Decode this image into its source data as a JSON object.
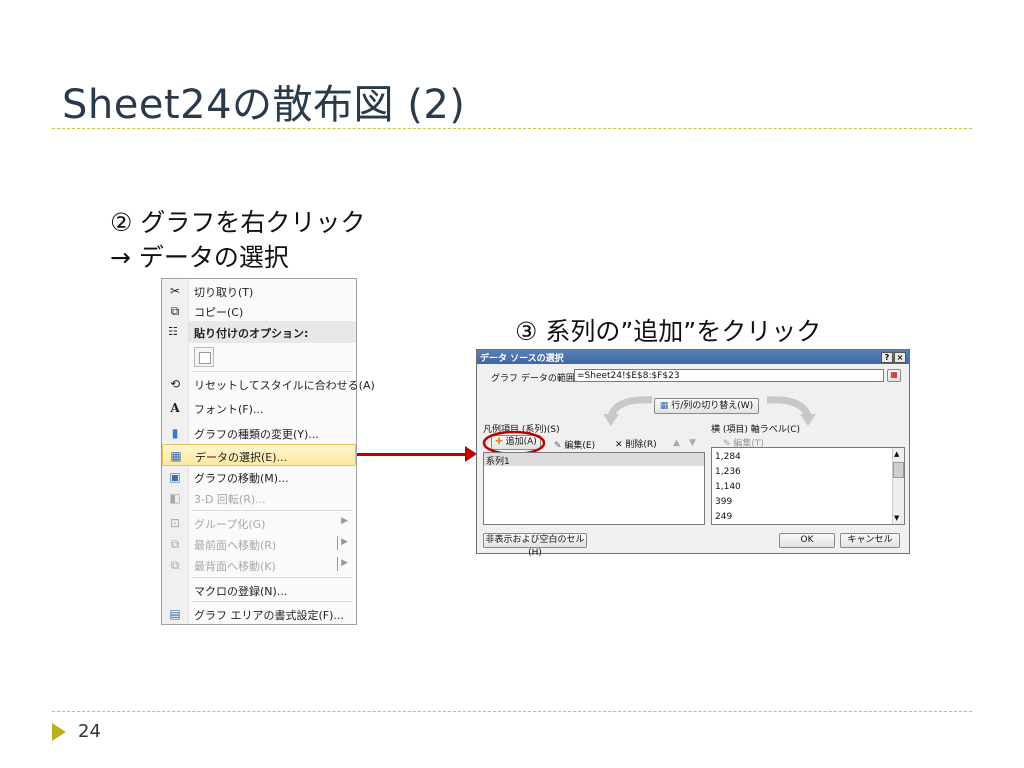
{
  "slide": {
    "title": "Sheet24の散布図 (2)",
    "step2_line1": "② グラフを右クリック",
    "step2_line2": "→ データの選択",
    "step3": "③ 系列の”追加”をクリック",
    "page_number": "24"
  },
  "context_menu": {
    "items": [
      {
        "icon": "scissors-icon",
        "glyph": "✂",
        "label": "切り取り(T)"
      },
      {
        "icon": "copy-icon",
        "glyph": "⧉",
        "label": "コピー(C)"
      },
      {
        "icon": "paste-icon",
        "glyph": "📋",
        "label": "貼り付けのオプション:"
      },
      {
        "icon": "reset-style-icon",
        "glyph": "⟲",
        "label": "リセットしてスタイルに合わせる(A)"
      },
      {
        "icon": "font-icon",
        "glyph": "A",
        "label": "フォント(F)..."
      },
      {
        "icon": "chart-type-icon",
        "glyph": "▮",
        "label": "グラフの種類の変更(Y)..."
      },
      {
        "icon": "select-data-icon",
        "glyph": "▦",
        "label": "データの選択(E)..."
      },
      {
        "icon": "move-chart-icon",
        "glyph": "▣",
        "label": "グラフの移動(M)..."
      },
      {
        "icon": "rotate-3d-icon",
        "glyph": "◧",
        "label": "3-D 回転(R)..."
      },
      {
        "icon": "group-icon",
        "glyph": "⊡",
        "label": "グループ化(G)"
      },
      {
        "icon": "bring-front-icon",
        "glyph": "⧉",
        "label": "最前面へ移動(R)"
      },
      {
        "icon": "send-back-icon",
        "glyph": "⧉",
        "label": "最背面へ移動(K)"
      },
      {
        "icon": "",
        "glyph": "",
        "label": "マクロの登録(N)..."
      },
      {
        "icon": "format-area-icon",
        "glyph": "▤",
        "label": "グラフ エリアの書式設定(F)..."
      }
    ]
  },
  "dialog": {
    "title": "データ ソースの選択",
    "help": "?",
    "close": "×",
    "range_label": "グラフ データの範囲(D):",
    "range_value": "=Sheet24!$E$8:$F$23",
    "switch_label": "行/列の切り替え(W)",
    "legend_label": "凡例項目 (系列)(S)",
    "add_label": "追加(A)",
    "edit_label": "編集(E)",
    "delete_label": "削除(R)",
    "series_item": "系列1",
    "axis_label": "横 (項目) 軸ラベル(C)",
    "axis_edit": "編集(T)",
    "axis_values": [
      "1,284",
      "1,236",
      "1,140",
      "399",
      "249"
    ],
    "hidden_cells": "非表示および空白のセル(H)",
    "ok": "OK",
    "cancel": "キャンセル"
  }
}
